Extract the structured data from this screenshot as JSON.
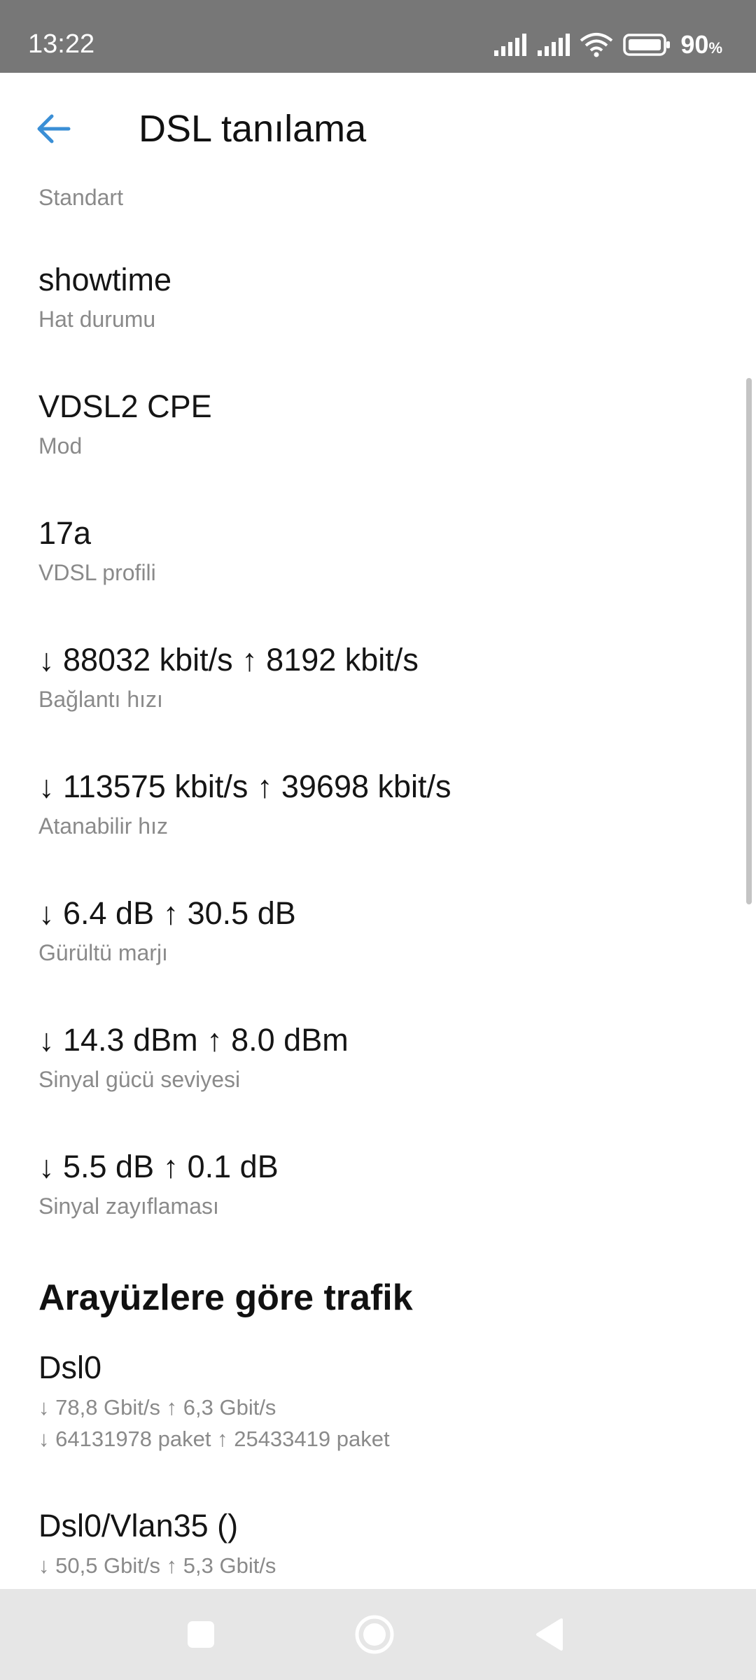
{
  "status_bar": {
    "time": "13:22",
    "battery_percent": "90",
    "battery_unit": "%",
    "icons": [
      "signal-icon",
      "signal-icon",
      "wifi-icon",
      "battery-icon"
    ]
  },
  "app_bar": {
    "title": "DSL tanılama",
    "back_icon": "arrow-back-icon",
    "accent_color": "#3a8fd6"
  },
  "rows": [
    {
      "value": "",
      "label": "Standart"
    },
    {
      "value": "showtime",
      "label": "Hat durumu"
    },
    {
      "value": "VDSL2 CPE",
      "label": "Mod"
    },
    {
      "value": "17a",
      "label": "VDSL profili"
    },
    {
      "value": "↓ 88032 kbit/s ↑ 8192 kbit/s",
      "label": "Bağlantı hızı"
    },
    {
      "value": "↓ 113575 kbit/s ↑ 39698 kbit/s",
      "label": "Atanabilir hız"
    },
    {
      "value": "↓ 6.4 dB ↑ 30.5 dB",
      "label": "Gürültü marjı"
    },
    {
      "value": "↓ 14.3 dBm ↑ 8.0 dBm",
      "label": "Sinyal gücü seviyesi"
    },
    {
      "value": "↓ 5.5 dB ↑ 0.1 dB",
      "label": "Sinyal zayıflaması"
    }
  ],
  "traffic_section": {
    "title": "Arayüzlere göre trafik",
    "interfaces": [
      {
        "name": "Dsl0",
        "rate": "↓ 78,8 Gbit/s ↑ 6,3 Gbit/s",
        "packets": "↓ 64131978 paket ↑ 25433419 paket"
      },
      {
        "name": "Dsl0/Vlan35 ()",
        "rate": "↓ 50,5 Gbit/s ↑ 5,3 Gbit/s",
        "packets": ""
      }
    ]
  },
  "nav_bar": {
    "buttons": [
      "recents-square-icon",
      "home-circle-icon",
      "back-triangle-icon"
    ]
  }
}
